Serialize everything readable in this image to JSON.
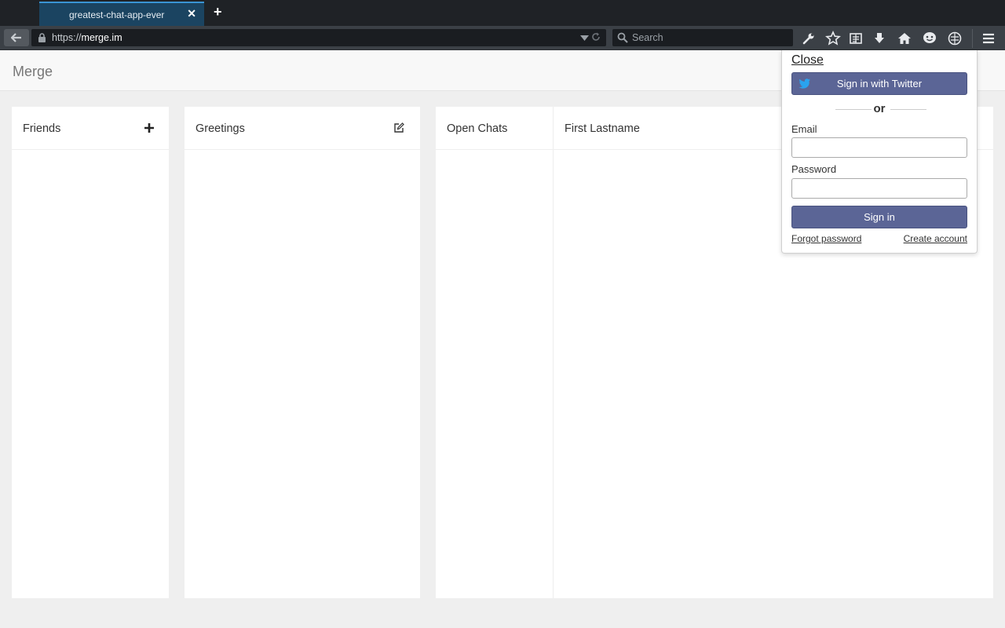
{
  "browser": {
    "tab_title": "greatest-chat-app-ever",
    "url_prefix": "https://",
    "url_host": "merge.im",
    "search_placeholder": "Search",
    "accent_color": "#3a94d4"
  },
  "header": {
    "brand": "Merge"
  },
  "panels": {
    "friends_title": "Friends",
    "greetings_title": "Greetings",
    "open_chats_title": "Open Chats",
    "chat_name": "First Lastname"
  },
  "login": {
    "close_label": "Close",
    "twitter_label": "Sign in with Twitter",
    "or_label": "or",
    "email_label": "Email",
    "email_value": "",
    "password_label": "Password",
    "password_value": "",
    "signin_label": "Sign in",
    "forgot_label": "Forgot password",
    "create_label": "Create account",
    "button_color": "#5b6596"
  },
  "icons": {
    "back": "arrow-left-icon",
    "lock": "lock-icon",
    "search": "search-icon",
    "toolbar": [
      "wrench-icon",
      "star-icon",
      "reader-icon",
      "download-icon",
      "home-icon",
      "chat-icon",
      "sync-icon",
      "menu-icon"
    ],
    "add_friend": "plus-icon",
    "compose": "edit-icon",
    "twitter": "twitter-bird-icon"
  }
}
